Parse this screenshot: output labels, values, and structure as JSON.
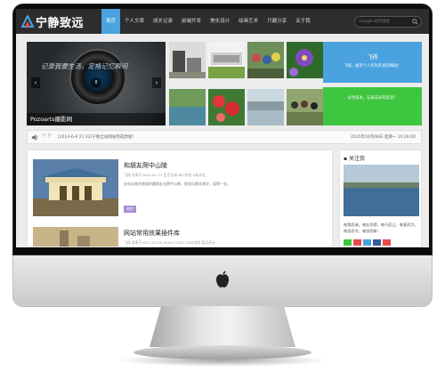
{
  "site": {
    "logo_text": "宁静致远",
    "nav": [
      "首页",
      "个人文章",
      "成长记录",
      "前端开发",
      "美化设计",
      "绘画艺术",
      "只藏分享",
      "关于我"
    ],
    "search_placeholder": "Google 站内搜索"
  },
  "hero": {
    "slogan": "记录我要生活，定格记忆瞬间",
    "caption": "Pozoarts摄影网",
    "prev_label": "‹",
    "next_label": "›",
    "pause_label": "II"
  },
  "tiles": {
    "blue": {
      "title": "飞扬",
      "text": "飞扬，展示个人作为开发的网站！"
    },
    "green": {
      "text": "分享技术，记录成长的足迹！"
    }
  },
  "ticker": {
    "controls": [
      "◁",
      "▷"
    ],
    "message": "[2014-6-9 21:32]宁静全站网站完成改版！",
    "date": "2015年04月06日 星期一 10:26:00"
  },
  "articles": [
    {
      "title": "和朋友爬中山陵",
      "meta": "飞扬   发表于2015-01-11   生活记录   867浏览   0条评论",
      "excerpt": "去年去南京旅游时跟朋友去爬中山陵，那里风景非常好，值得一去。",
      "tag": "南京"
    },
    {
      "title": "网站常用效果插件库",
      "meta": "飞扬   发表于2015-01-05   html5 CSS3   1385浏览   暂无评论",
      "excerpt": "",
      "tag": ""
    }
  ],
  "sidebar": {
    "title": "关注我",
    "text": "唯我而诚，唯在而得，唯行而立，唯意而为，唯思而专，唯创而新！"
  },
  "colors": {
    "accent_blue": "#4aa3df",
    "accent_green": "#3fc640",
    "tag_purple": "#a98ed6",
    "nav_bg": "#2d2d2d"
  }
}
